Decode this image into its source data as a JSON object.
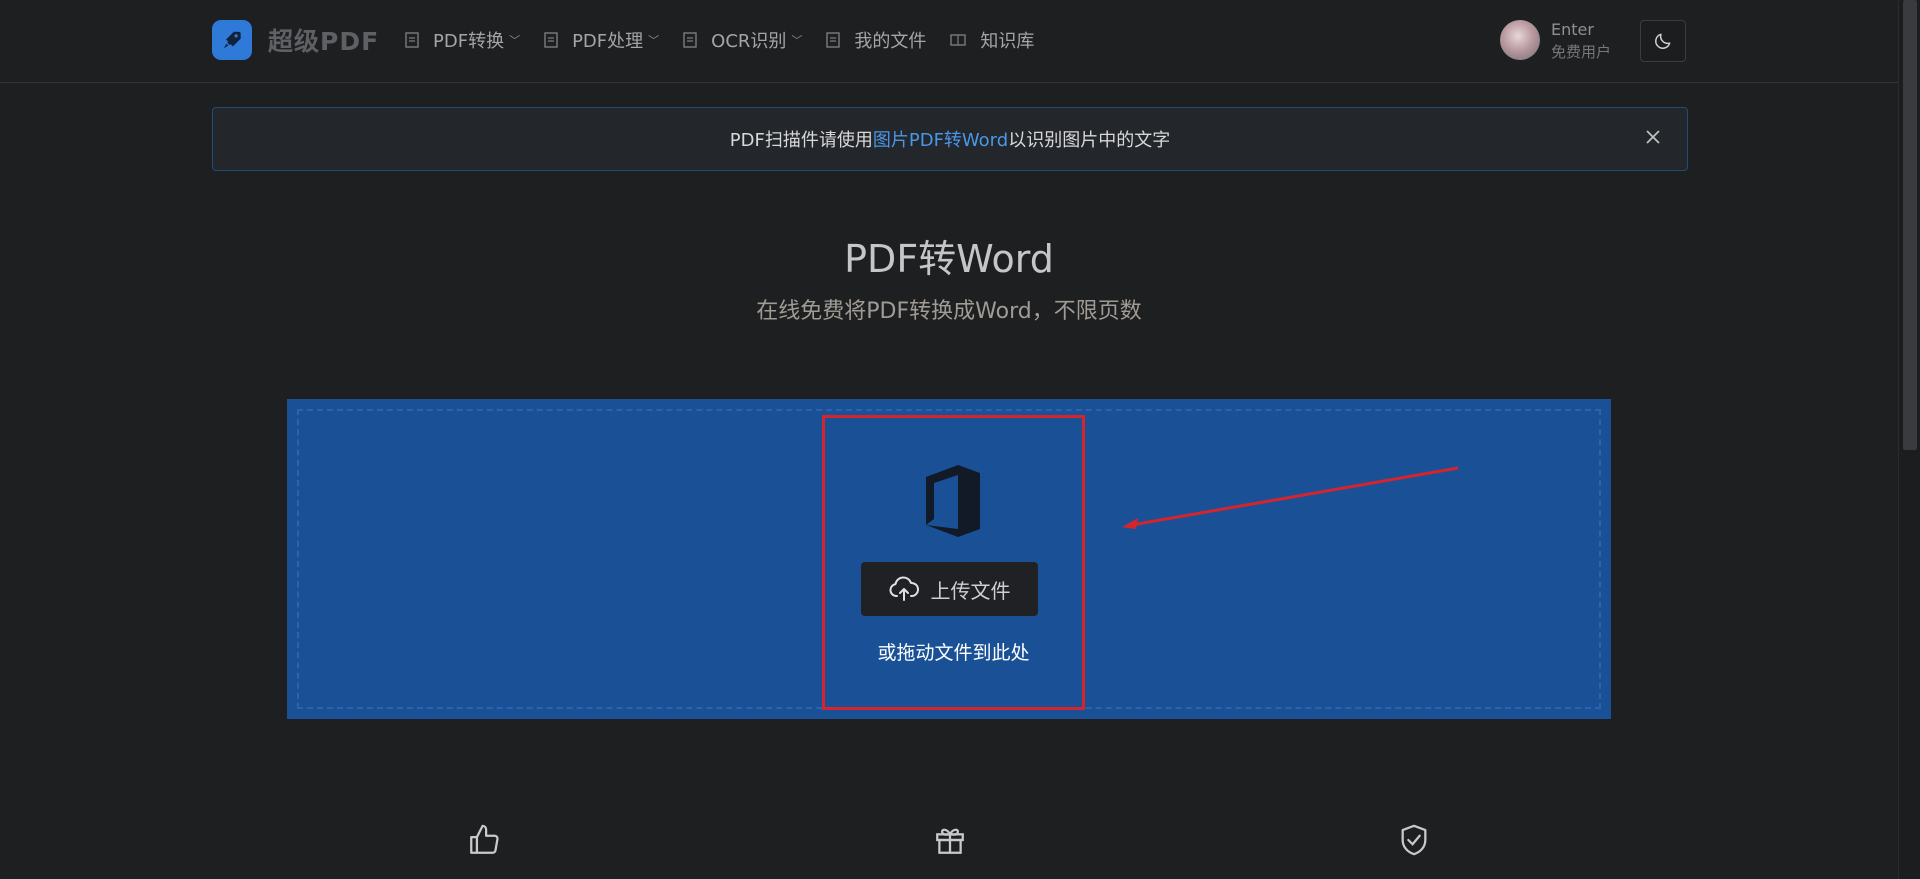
{
  "brand": {
    "name": "超级PDF"
  },
  "nav": [
    {
      "label": "PDF转换",
      "has_dropdown": true
    },
    {
      "label": "PDF处理",
      "has_dropdown": true
    },
    {
      "label": "OCR识别",
      "has_dropdown": true
    },
    {
      "label": "我的文件",
      "has_dropdown": false
    },
    {
      "label": "知识库",
      "has_dropdown": false
    }
  ],
  "user": {
    "name": "Enter",
    "level": "免费用户"
  },
  "alert": {
    "prefix": "PDF扫描件请使用",
    "link": "图片PDF转Word",
    "suffix": "以识别图片中的文字"
  },
  "page": {
    "title": "PDF转Word",
    "subtitle": "在线免费将PDF转换成Word，不限页数"
  },
  "upload": {
    "button_label": "上传文件",
    "drag_hint": "或拖动文件到此处"
  },
  "colors": {
    "background": "#1e1f21",
    "dropzone": "#1a5196",
    "brand_blue": "#2f79d8",
    "highlight_red": "#d6242d",
    "link": "#4a97e6"
  },
  "icons": [
    "rocket-icon",
    "file-icon",
    "chevron-down-icon",
    "moon-icon",
    "close-icon",
    "office-icon",
    "cloud-upload-icon",
    "thumbs-up-icon",
    "gift-icon",
    "shield-check-icon"
  ]
}
